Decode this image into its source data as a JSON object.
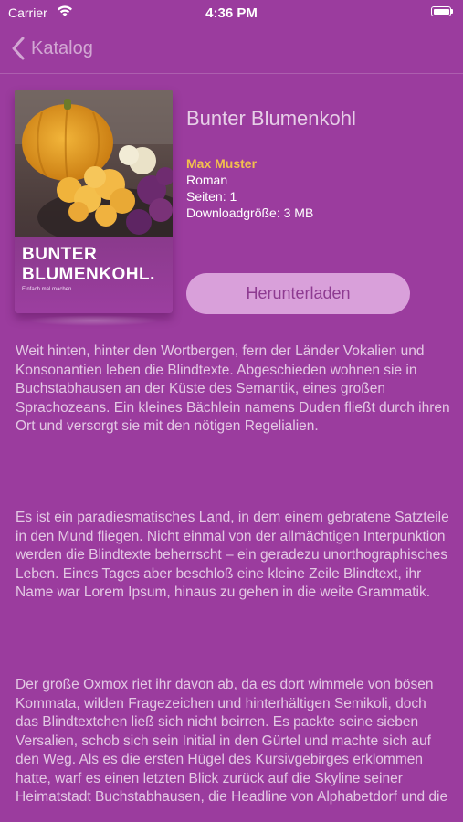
{
  "status_bar": {
    "carrier": "Carrier",
    "time": "4:36 PM"
  },
  "nav": {
    "back_label": "Katalog"
  },
  "book": {
    "cover_title_line1": "BUNTER",
    "cover_title_line2": "BLUMENKOHL.",
    "cover_subtitle": "Einfach mal machen.",
    "title": "Bunter Blumenkohl",
    "author": "Max Muster",
    "genre": "Roman",
    "pages": "Seiten: 1",
    "download_size": "Downloadgröße: 3 MB",
    "download_button": "Herunterladen"
  },
  "description": [
    "Weit hinten, hinter den Wortbergen, fern der Länder Vokalien und Konsonantien leben die Blindtexte. Abgeschieden wohnen sie in Buchstabhausen an der Küste des Semantik, eines großen Sprachozeans. Ein kleines Bächlein namens Duden fließt durch ihren Ort und versorgt sie mit den nötigen Regelialien.",
    "Es ist ein paradiesmatisches Land, in dem einem gebratene Satzteile in den Mund fliegen. Nicht einmal von der allmächtigen Interpunktion werden die Blindtexte beherrscht – ein geradezu unorthographisches Leben. Eines Tages aber beschloß eine kleine Zeile Blindtext, ihr Name war Lorem Ipsum, hinaus zu gehen in die weite Grammatik.",
    "Der große Oxmox riet ihr davon ab, da es dort wimmele von bösen Kommata, wilden Fragezeichen und hinterhältigen Semikoli, doch das Blindtextchen ließ sich nicht beirren. Es packte seine sieben Versalien, schob sich sein Initial in den Gürtel und machte sich auf den Weg. Als es die ersten Hügel des Kursivgebirges erklommen hatte, warf es einen letzten Blick zurück auf die Skyline seiner Heimatstadt Buchstabhausen, die Headline von Alphabetdorf und die"
  ],
  "colors": {
    "background": "#9b3c9e",
    "accent_author": "#f3c04d",
    "button_bg": "#d9a0da",
    "button_text": "#8e3b91"
  }
}
